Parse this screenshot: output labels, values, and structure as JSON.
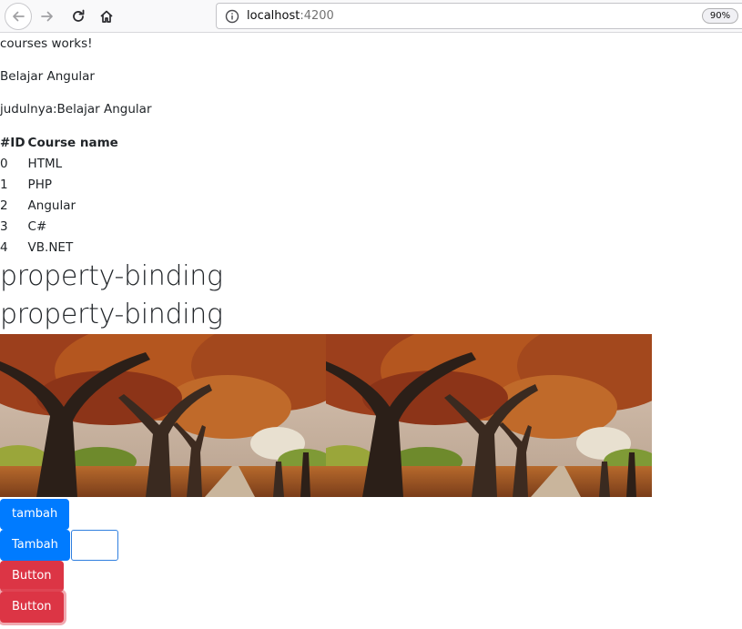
{
  "browser": {
    "url_host": "localhost",
    "url_port": ":4200",
    "zoom": "90%",
    "icons": {
      "back": "back-arrow-icon",
      "forward": "forward-arrow-icon",
      "reload": "reload-icon",
      "home": "home-icon",
      "info": "info-icon"
    }
  },
  "page": {
    "courses_works": "courses works!",
    "title": "Belajar Angular",
    "judul_line": "judulnya:Belajar Angular",
    "table": {
      "headers": [
        "#ID",
        "Course name"
      ],
      "rows": [
        {
          "id": "0",
          "name": "HTML"
        },
        {
          "id": "1",
          "name": "PHP"
        },
        {
          "id": "2",
          "name": "Angular"
        },
        {
          "id": "3",
          "name": "C#"
        },
        {
          "id": "4",
          "name": "VB.NET"
        }
      ]
    },
    "headings": [
      "property-binding",
      "property-binding"
    ],
    "buttons": {
      "tambah_lower": "tambah",
      "tambah_upper": "Tambah",
      "button_1": "Button",
      "button_2": "Button"
    },
    "input_value": ""
  },
  "colors": {
    "primary": "#007bff",
    "danger": "#dc3545"
  }
}
